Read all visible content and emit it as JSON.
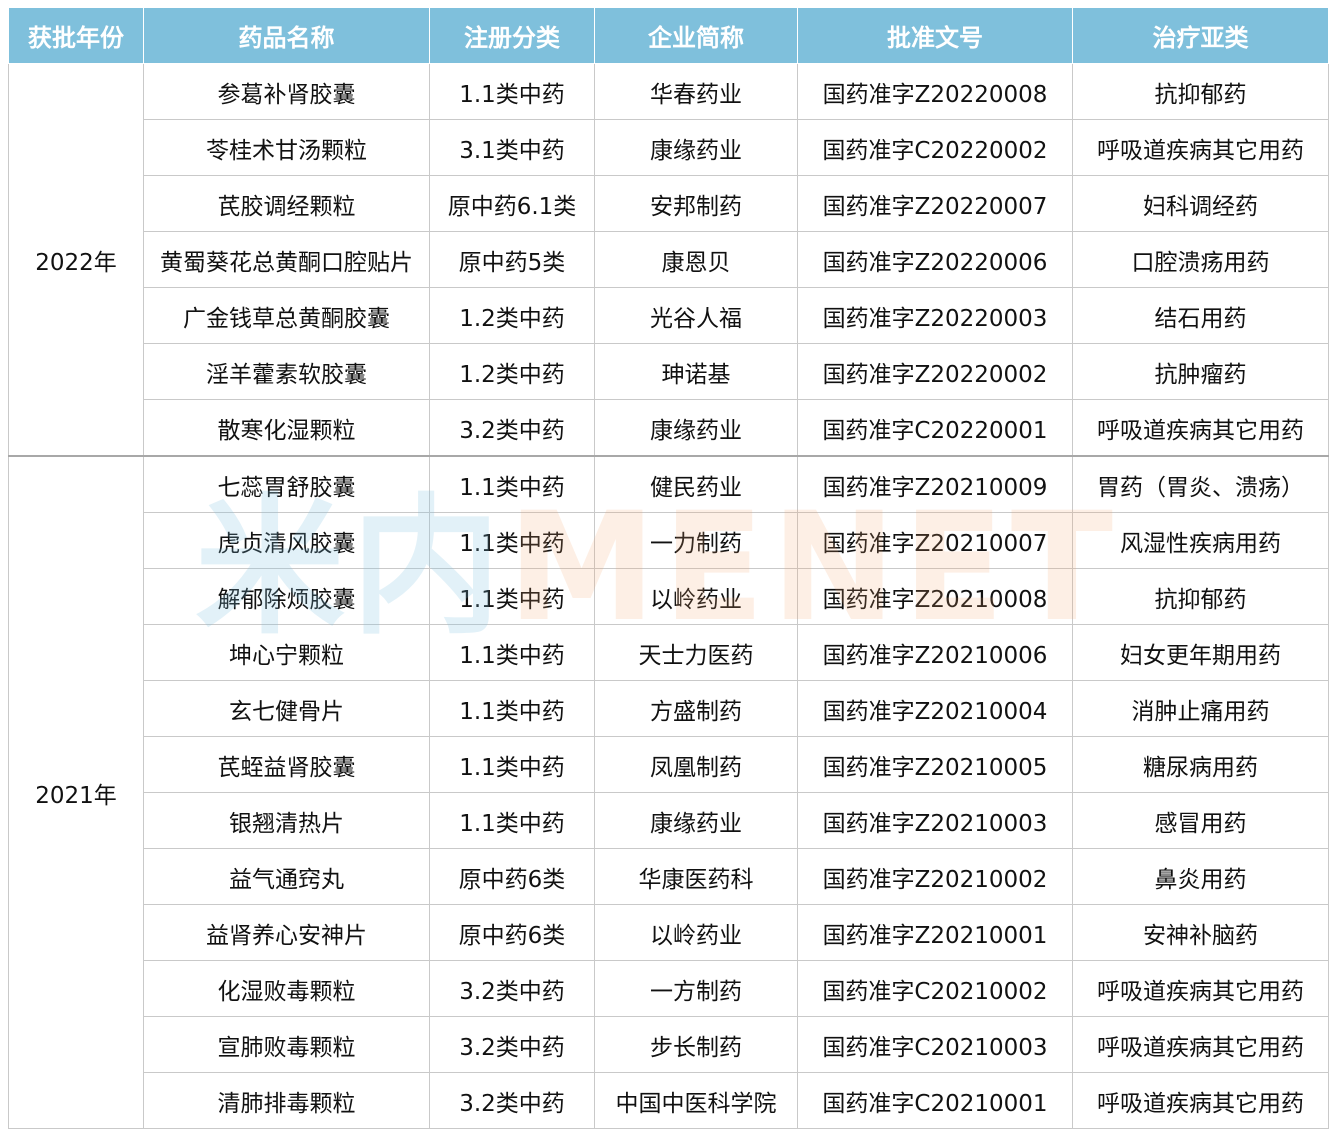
{
  "headers": [
    "获批年份",
    "药品名称",
    "注册分类",
    "企业简称",
    "批准文号",
    "治疗亚类"
  ],
  "groups": [
    {
      "year": "2022年",
      "rows": [
        [
          "参葛补肾胶囊",
          "1.1类中药",
          "华春药业",
          "国药准字Z20220008",
          "抗抑郁药"
        ],
        [
          "苓桂术甘汤颗粒",
          "3.1类中药",
          "康缘药业",
          "国药准字C20220002",
          "呼吸道疾病其它用药"
        ],
        [
          "芪胶调经颗粒",
          "原中药6.1类",
          "安邦制药",
          "国药准字Z20220007",
          "妇科调经药"
        ],
        [
          "黄蜀葵花总黄酮口腔贴片",
          "原中药5类",
          "康恩贝",
          "国药准字Z20220006",
          "口腔溃疡用药"
        ],
        [
          "广金钱草总黄酮胶囊",
          "1.2类中药",
          "光谷人福",
          "国药准字Z20220003",
          "结石用药"
        ],
        [
          "淫羊藿素软胶囊",
          "1.2类中药",
          "珅诺基",
          "国药准字Z20220002",
          "抗肿瘤药"
        ],
        [
          "散寒化湿颗粒",
          "3.2类中药",
          "康缘药业",
          "国药准字C20220001",
          "呼吸道疾病其它用药"
        ]
      ]
    },
    {
      "year": "2021年",
      "rows": [
        [
          "七蕊胃舒胶囊",
          "1.1类中药",
          "健民药业",
          "国药准字Z20210009",
          "胃药（胃炎、溃疡）"
        ],
        [
          "虎贞清风胶囊",
          "1.1类中药",
          "一力制药",
          "国药准字Z20210007",
          "风湿性疾病用药"
        ],
        [
          "解郁除烦胶囊",
          "1.1类中药",
          "以岭药业",
          "国药准字Z20210008",
          "抗抑郁药"
        ],
        [
          "坤心宁颗粒",
          "1.1类中药",
          "天士力医药",
          "国药准字Z20210006",
          "妇女更年期用药"
        ],
        [
          "玄七健骨片",
          "1.1类中药",
          "方盛制药",
          "国药准字Z20210004",
          "消肿止痛用药"
        ],
        [
          "芪蛭益肾胶囊",
          "1.1类中药",
          "凤凰制药",
          "国药准字Z20210005",
          "糖尿病用药"
        ],
        [
          "银翘清热片",
          "1.1类中药",
          "康缘药业",
          "国药准字Z20210003",
          "感冒用药"
        ],
        [
          "益气通窍丸",
          "原中药6类",
          "华康医药科",
          "国药准字Z20210002",
          "鼻炎用药"
        ],
        [
          "益肾养心安神片",
          "原中药6类",
          "以岭药业",
          "国药准字Z20210001",
          "安神补脑药"
        ],
        [
          "化湿败毒颗粒",
          "3.2类中药",
          "一方制药",
          "国药准字C20210002",
          "呼吸道疾病其它用药"
        ],
        [
          "宣肺败毒颗粒",
          "3.2类中药",
          "步长制药",
          "国药准字C20210003",
          "呼吸道疾病其它用药"
        ],
        [
          "清肺排毒颗粒",
          "3.2类中药",
          "中国中医科学院",
          "国药准字C20210001",
          "呼吸道疾病其它用药"
        ]
      ]
    }
  ],
  "watermark": {
    "logo": "米内",
    "text": "MENET"
  },
  "colors": {
    "header_bg": "#7fc0dc",
    "header_text": "#ffffff",
    "border": "#c9c9c9"
  }
}
